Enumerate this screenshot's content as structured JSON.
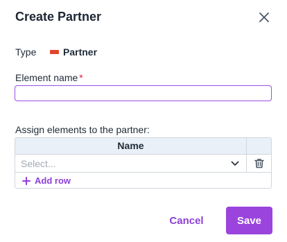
{
  "dialog": {
    "title": "Create Partner"
  },
  "type_row": {
    "label": "Type",
    "value": "Partner",
    "swatch_color": "#e0452b"
  },
  "element_name": {
    "label": "Element name",
    "required_marker": "*",
    "value": "",
    "placeholder": ""
  },
  "assign": {
    "label": "Assign elements to the partner:",
    "table": {
      "columns": [
        "Name"
      ],
      "rows": [
        {
          "select_placeholder": "Select..."
        }
      ],
      "add_row_label": "Add row"
    }
  },
  "footer": {
    "cancel_label": "Cancel",
    "save_label": "Save"
  },
  "colors": {
    "accent": "#9a44dd",
    "required": "#d81b3c",
    "header_bg": "#e9f0f7"
  },
  "icons": {
    "close": "close-icon",
    "chevron": "chevron-down-icon",
    "delete": "trash-icon",
    "add": "plus-icon"
  }
}
